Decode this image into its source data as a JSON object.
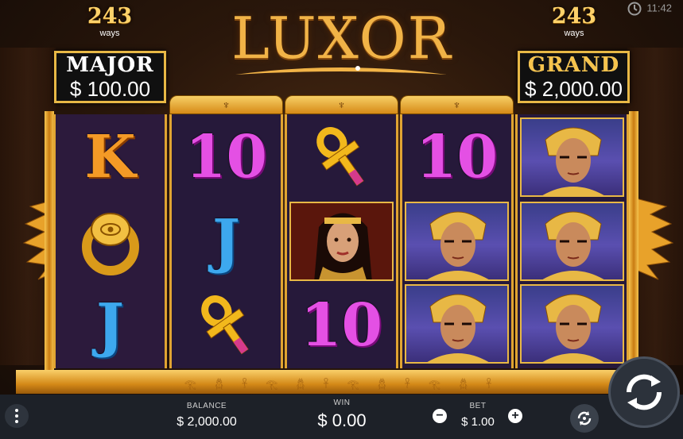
{
  "header": {
    "left_ways": {
      "value": "243",
      "label": "ways"
    },
    "right_ways": {
      "value": "243",
      "label": "ways"
    },
    "logo_text": "LUXOR",
    "clock": "11:42"
  },
  "jackpots": {
    "major": {
      "name": "MAJOR",
      "value": "$ 100.00"
    },
    "grand": {
      "name": "GRAND",
      "value": "$ 2,000.00"
    }
  },
  "reels": [
    [
      "K",
      "ring",
      "J"
    ],
    [
      "10",
      "J",
      "ankh"
    ],
    [
      "ankh",
      "queen",
      "10"
    ],
    [
      "10",
      "pharaoh",
      "pharaoh"
    ],
    [
      "pharaoh",
      "pharaoh",
      "pharaoh"
    ]
  ],
  "footer": {
    "balance_label": "BALANCE",
    "balance_value": "$ 2,000.00",
    "win_label": "WIN",
    "win_value": "$ 0.00",
    "bet_label": "BET",
    "bet_value": "$ 1.00",
    "minus": "−",
    "plus": "+"
  },
  "colors": {
    "gold": "#e8b845",
    "panel_bg": "#1d2128",
    "reel_bg": "#2c1a3c"
  }
}
